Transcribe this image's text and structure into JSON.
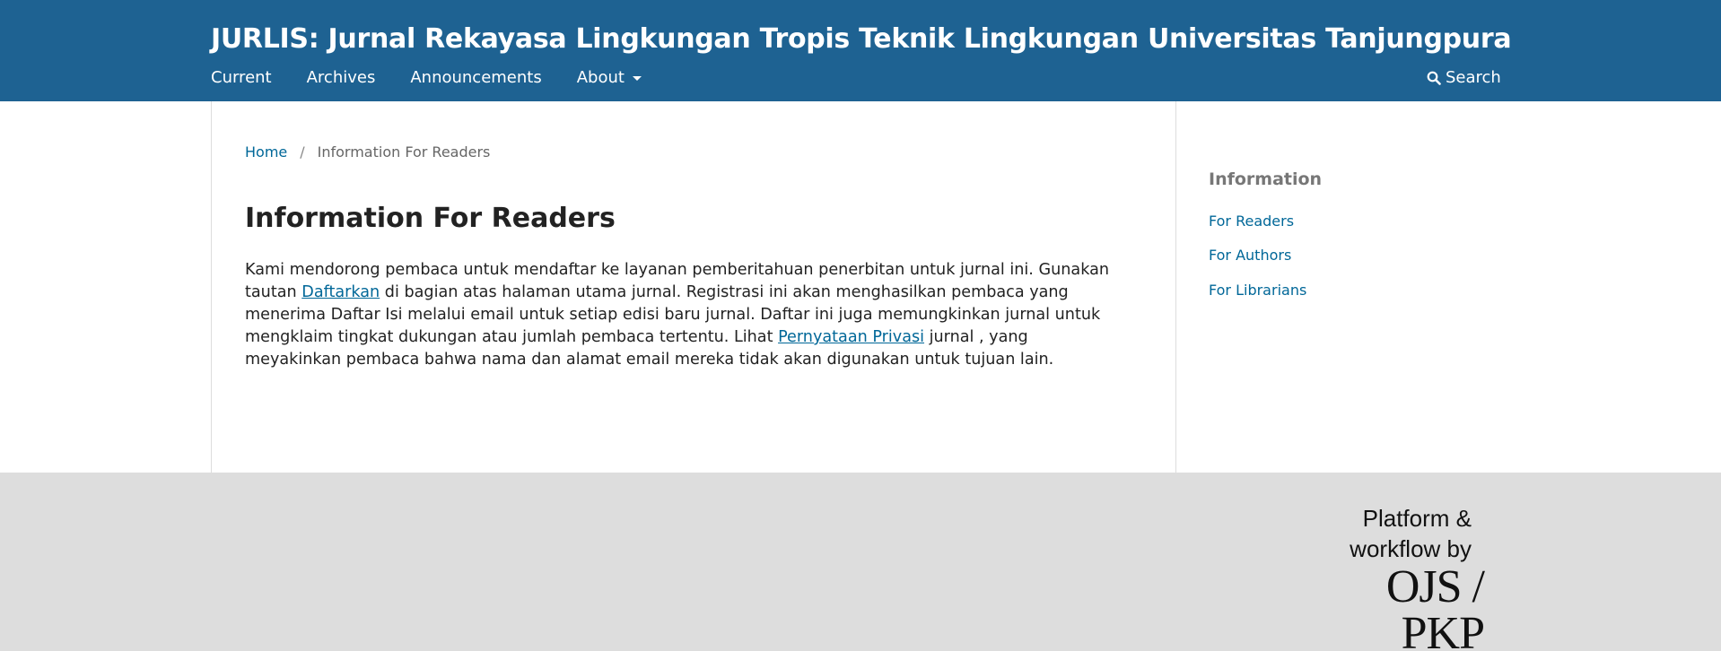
{
  "header": {
    "site_title": "JURLIS: Jurnal Rekayasa Lingkungan Tropis Teknik Lingkungan Universitas Tanjungpura",
    "nav": [
      "Current",
      "Archives",
      "Announcements",
      "About"
    ],
    "search_label": "Search"
  },
  "breadcrumb": {
    "home": "Home",
    "separator": "/",
    "current": "Information For Readers"
  },
  "main": {
    "title": "Information For Readers",
    "text_1": "Kami mendorong pembaca untuk mendaftar ke layanan pemberitahuan penerbitan untuk jurnal ini. Gunakan tautan ",
    "link_1": "Daftarkan",
    "text_2": " di bagian atas halaman utama jurnal. Registrasi ini akan menghasilkan pembaca yang menerima Daftar Isi melalui email untuk setiap edisi baru jurnal. Daftar ini juga memungkinkan jurnal untuk mengklaim tingkat dukungan atau jumlah pembaca tertentu. Lihat ",
    "link_2": "Pernyataan Privasi",
    "text_3": " jurnal , yang meyakinkan pembaca bahwa nama dan alamat email mereka tidak akan digunakan untuk tujuan lain."
  },
  "sidebar": {
    "title": "Information",
    "links": [
      "For Readers",
      "For Authors",
      "For Librarians"
    ]
  },
  "footer": {
    "pkp_line1a": "Platform &",
    "pkp_line1b": "workflow by",
    "pkp_line2": "OJS / PKP"
  },
  "colors": {
    "header_bg": "#1e6292",
    "link": "#006798",
    "footer_bg": "#dddddd"
  }
}
